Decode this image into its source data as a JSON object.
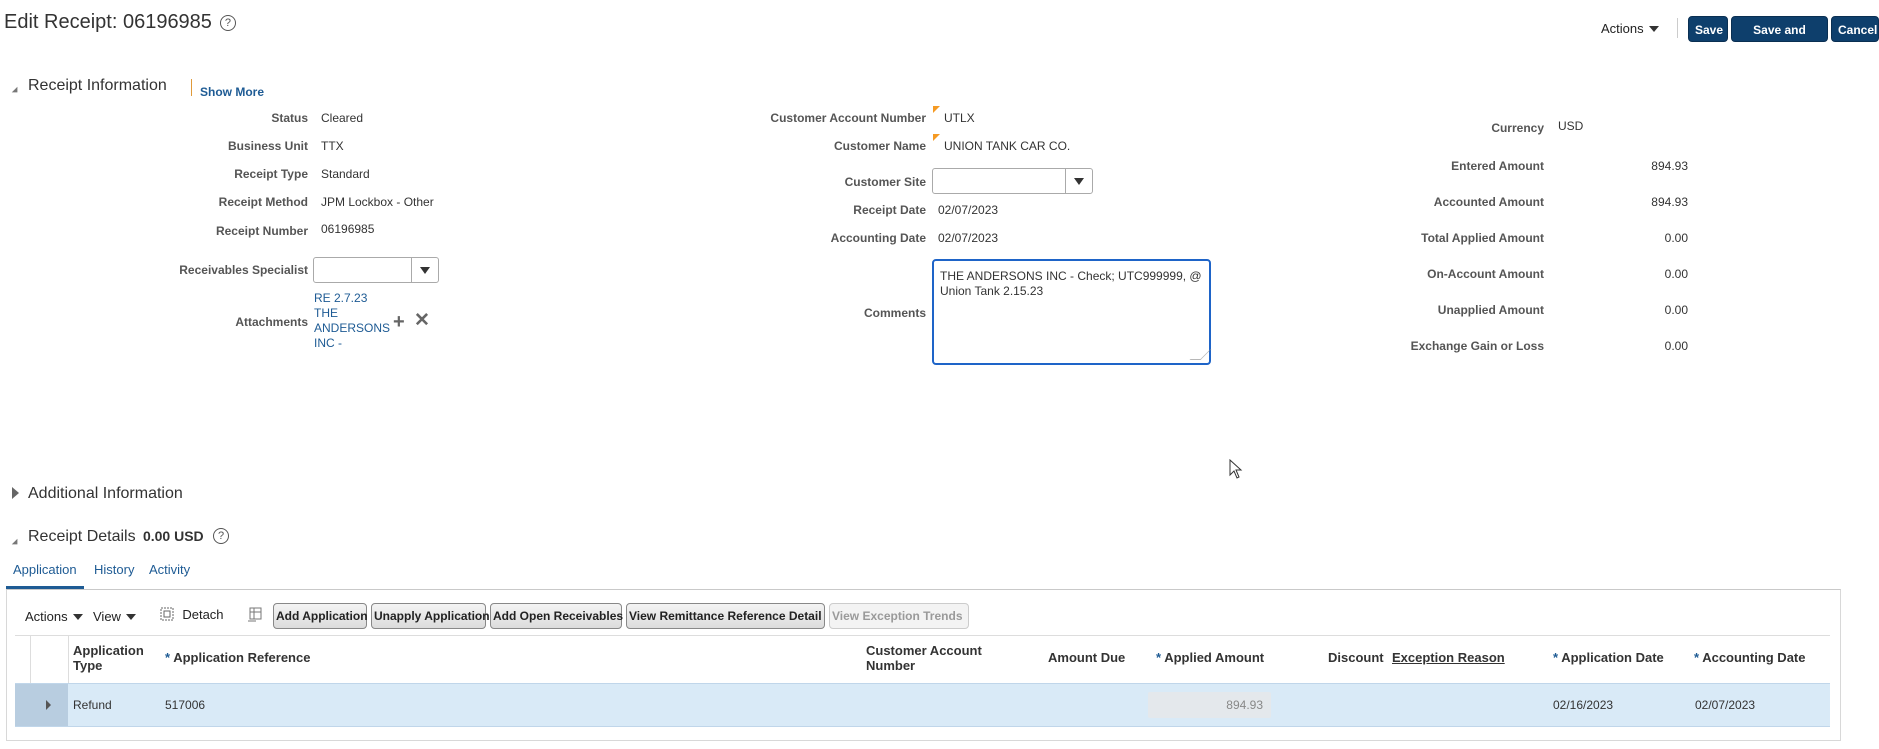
{
  "page": {
    "title": "Edit Receipt: 06196985",
    "actions_label": "Actions",
    "save_label": "Save",
    "save_close_label": "Save and Close",
    "cancel_label": "Cancel"
  },
  "receipt_info": {
    "section_title": "Receipt Information",
    "show_more": "Show More",
    "left": [
      {
        "label": "Status",
        "value": "Cleared"
      },
      {
        "label": "Business Unit",
        "value": "TTX"
      },
      {
        "label": "Receipt Type",
        "value": "Standard"
      },
      {
        "label": "Receipt Method",
        "value": "JPM Lockbox - Other"
      },
      {
        "label": "Receipt Number",
        "value": "06196985"
      }
    ],
    "receivables_specialist_label": "Receivables Specialist",
    "receivables_specialist_value": "",
    "attachments_label": "Attachments",
    "attachment_lines": [
      "RE 2.7.23",
      "THE",
      "ANDERSONS",
      "INC -"
    ],
    "middle": {
      "customer_account_number_label": "Customer Account Number",
      "customer_account_number_value": "UTLX",
      "customer_name_label": "Customer Name",
      "customer_name_value": "UNION TANK CAR CO.",
      "customer_site_label": "Customer Site",
      "customer_site_value": "",
      "receipt_date_label": "Receipt Date",
      "receipt_date_value": "02/07/2023",
      "accounting_date_label": "Accounting Date",
      "accounting_date_value": "02/07/2023",
      "comments_label": "Comments",
      "comments_value": "THE ANDERSONS INC - Check; UTC999999, @ Union Tank 2.15.23"
    },
    "right": {
      "currency_label": "Currency",
      "currency_value": "USD",
      "amounts": [
        {
          "label": "Entered Amount",
          "value": "894.93"
        },
        {
          "label": "Accounted Amount",
          "value": "894.93"
        },
        {
          "label": "Total Applied Amount",
          "value": "0.00"
        },
        {
          "label": "On-Account Amount",
          "value": "0.00"
        },
        {
          "label": "Unapplied Amount",
          "value": "0.00"
        },
        {
          "label": "Exchange Gain or Loss",
          "value": "0.00"
        }
      ]
    }
  },
  "additional_info": {
    "section_title": "Additional Information"
  },
  "receipt_details": {
    "section_title": "Receipt Details",
    "amount": "0.00 USD",
    "tabs": [
      "Application",
      "History",
      "Activity"
    ],
    "toolbar": {
      "actions": "Actions",
      "view": "View",
      "detach": "Detach",
      "add_application": "Add Application",
      "unapply_application": "Unapply Application",
      "add_open_receivables": "Add Open Receivables",
      "view_remittance": "View Remittance Reference Detail",
      "view_exception_trends": "View Exception Trends"
    },
    "columns": {
      "application_type": "Application Type",
      "application_reference": "Application Reference",
      "customer_account_number": "Customer Account Number",
      "amount_due": "Amount Due",
      "applied_amount": "Applied Amount",
      "discount": "Discount",
      "exception_reason": "Exception Reason",
      "application_date": "Application Date",
      "accounting_date": "Accounting Date"
    },
    "rows": [
      {
        "application_type": "Refund",
        "application_reference": "517006",
        "customer_account_number": "",
        "amount_due": "",
        "applied_amount": "894.93",
        "discount": "",
        "exception_reason": "",
        "application_date": "02/16/2023",
        "accounting_date": "02/07/2023"
      }
    ]
  }
}
